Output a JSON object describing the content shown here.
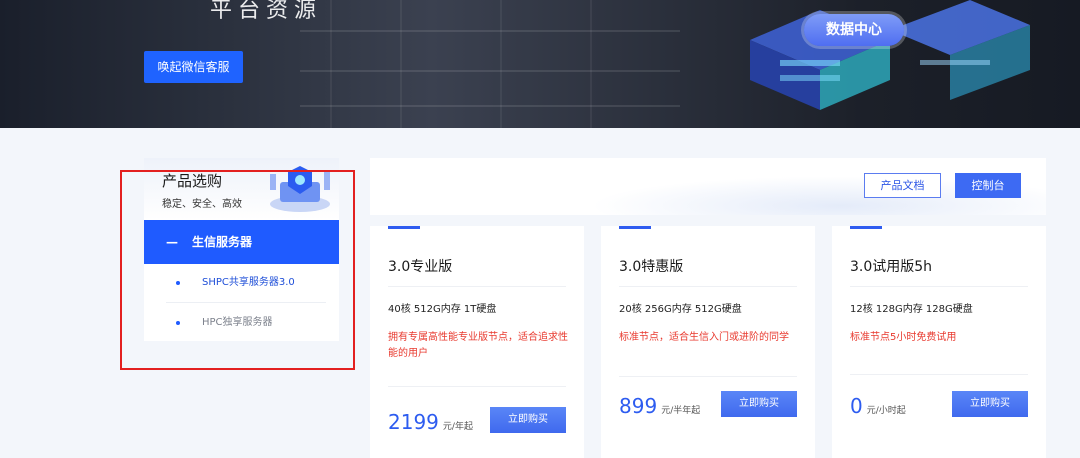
{
  "banner": {
    "headline_stub": "平台资源",
    "wechat_button": "唤起微信客服",
    "art_label": "数据中心"
  },
  "sidebar": {
    "title": "产品选购",
    "subtitle": "稳定、安全、高效",
    "active_group": {
      "marker": "—",
      "label": "生信服务器"
    },
    "items": [
      {
        "label": "SHPC共享服务器3.0"
      },
      {
        "label": "HPC独享服务器"
      }
    ]
  },
  "toolbar": {
    "docs_label": "产品文档",
    "console_label": "控制台"
  },
  "cards": [
    {
      "name": "3.0专业版",
      "spec": "40核 512G内存 1T硬盘",
      "desc": "拥有专属高性能专业版节点，适合追求性能的用户",
      "price": "2199",
      "unit": "元/年起",
      "buy": "立即购买"
    },
    {
      "name": "3.0特惠版",
      "spec": "20核 256G内存 512G硬盘",
      "desc": "标准节点，适合生信入门或进阶的同学",
      "price": "899",
      "unit": "元/半年起",
      "buy": "立即购买"
    },
    {
      "name": "3.0试用版5h",
      "spec": "12核 128G内存 128G硬盘",
      "desc": "标准节点5小时免费试用",
      "price": "0",
      "unit": "元/小时起",
      "buy": "立即购买"
    }
  ],
  "colors": {
    "accent": "#1f5bff",
    "warning_text": "#e83a2f",
    "annotation_box": "#e32020"
  }
}
